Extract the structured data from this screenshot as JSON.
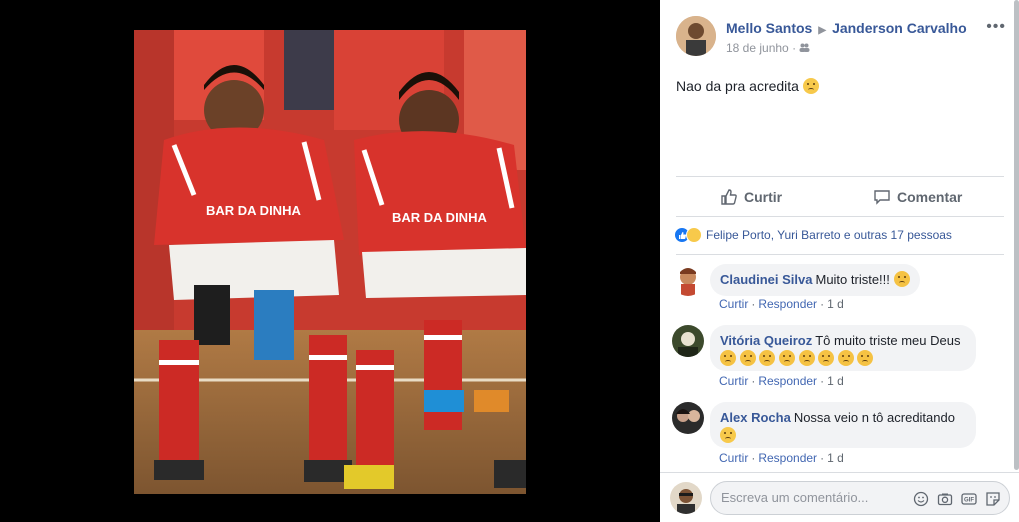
{
  "post": {
    "author": "Mello Santos",
    "target": "Janderson Carvalho",
    "date": "18 de junho",
    "audience_icon": "friends-icon",
    "text": "Nao da pra acredita",
    "text_emoji": "crying-face-icon",
    "more_icon": "more-options-icon"
  },
  "actions": {
    "like_label": "Curtir",
    "comment_label": "Comentar"
  },
  "reactions": {
    "summary": "Felipe Porto, Yuri Barreto e outras 17 pessoas"
  },
  "comments": [
    {
      "author": "Claudinei Silva",
      "text": "Muito triste!!!",
      "emoji_count": 1,
      "reply_like": "Curtir",
      "reply": "Responder",
      "time": "1 d"
    },
    {
      "author": "Vitória Queiroz",
      "text": "Tô muito triste meu Deus",
      "emoji_count": 8,
      "reply_like": "Curtir",
      "reply": "Responder",
      "time": "1 d"
    },
    {
      "author": "Alex Rocha",
      "text": "Nossa veio n tô acreditando",
      "emoji_count": 1,
      "reply_like": "Curtir",
      "reply": "Responder",
      "time": "1 d"
    }
  ],
  "composer": {
    "placeholder": "Escreva um comentário...",
    "icons": [
      "emoji-icon",
      "camera-icon",
      "gif-icon",
      "sticker-icon"
    ]
  },
  "photo": {
    "jersey_text": "BAR DA DINHA",
    "colors": {
      "jersey": "#d8332c",
      "shorts": "#f2f0ec",
      "sock": "#cc2a25",
      "floor": "#9a6a3a"
    }
  },
  "colors": {
    "link": "#385898",
    "meta": "#90949c",
    "bubble": "#f2f3f5",
    "accent": "#1877f2"
  }
}
